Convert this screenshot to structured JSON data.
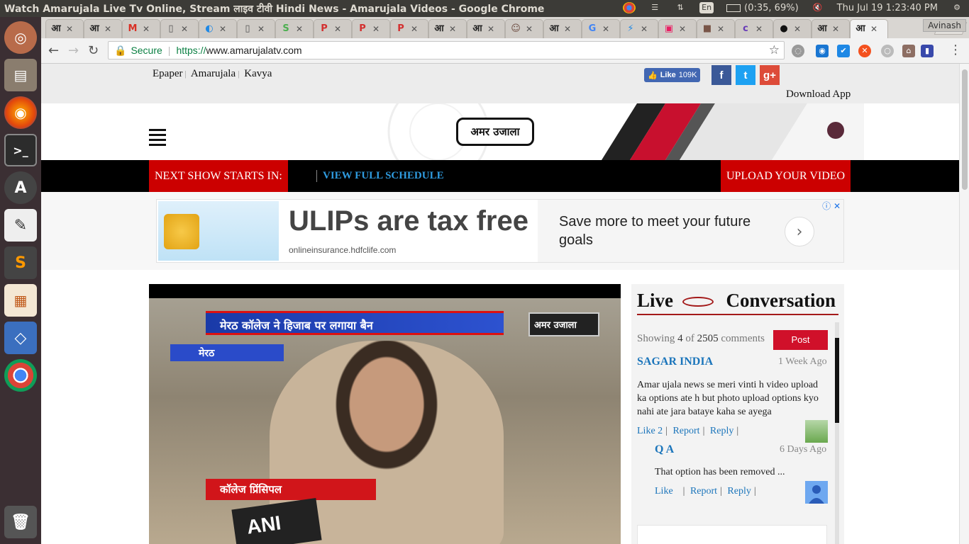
{
  "os": {
    "window_title": "Watch Amarujala Live Tv Online, Stream लाइव टीवी Hindi News - Amarujala Videos - Google Chrome",
    "battery": "(0:35, 69%)",
    "clock": "Thu Jul 19  1:23:40 PM",
    "keyboard": "En",
    "user": "Avinash"
  },
  "launcher": [
    "ubuntu-icon",
    "files-icon",
    "firefox-icon",
    "terminal-icon",
    "software-updater-icon",
    "text-editor-icon",
    "sublime-icon",
    "impress-icon",
    "virtualbox-icon",
    "chrome-icon",
    "trash-icon"
  ],
  "tabs": [
    {
      "icon": "आ",
      "color": "#222"
    },
    {
      "icon": "आ",
      "color": "#222"
    },
    {
      "icon": "M",
      "color": "#d93025"
    },
    {
      "icon": "▯",
      "color": "#555"
    },
    {
      "icon": "◐",
      "color": "#1e88e5"
    },
    {
      "icon": "▯",
      "color": "#555"
    },
    {
      "icon": "S",
      "color": "#4caf50"
    },
    {
      "icon": "P",
      "color": "#d32f2f"
    },
    {
      "icon": "P",
      "color": "#d32f2f"
    },
    {
      "icon": "P",
      "color": "#d32f2f"
    },
    {
      "icon": "आ",
      "color": "#222"
    },
    {
      "icon": "आ",
      "color": "#222"
    },
    {
      "icon": "☺",
      "color": "#6d4c41"
    },
    {
      "icon": "आ",
      "color": "#222"
    },
    {
      "icon": "G",
      "color": "#4285f4"
    },
    {
      "icon": "⚡",
      "color": "#1e88e5"
    },
    {
      "icon": "▣",
      "color": "#e91e63"
    },
    {
      "icon": "■",
      "color": "#795548"
    },
    {
      "icon": "c",
      "color": "#673ab7"
    },
    {
      "icon": "●",
      "color": "#111"
    },
    {
      "icon": "आ",
      "color": "#222"
    },
    {
      "icon": "आ",
      "color": "#222"
    }
  ],
  "omnibox": {
    "secure": "Secure",
    "protocol": "https://",
    "host": "www.amarujalatv.com"
  },
  "site": {
    "top_links": [
      "Epaper",
      "Amarujala",
      "Kavya"
    ],
    "fb_like": "Like",
    "fb_like_count": "109K",
    "social": [
      {
        "icon": "f",
        "color": "#3b5998"
      },
      {
        "icon": "t",
        "color": "#1da1f2"
      },
      {
        "icon": "g+",
        "color": "#dd4b39"
      }
    ],
    "download_app": "Download App",
    "logo_text": "अमर उजाला",
    "next_show": "NEXT SHOW STARTS IN:",
    "view_schedule": "VIEW FULL SCHEDULE",
    "upload_video": "UPLOAD YOUR VIDEO"
  },
  "ad": {
    "headline": "ULIPs are tax free",
    "domain": "onlineinsurance.hdfclife.com",
    "cta_text": "Save more to meet your future goals",
    "info": "ⓘ ✕"
  },
  "video": {
    "ticker": "मेरठ कॉलेज ने हिजाब पर लगाया बैन",
    "location": "मेरठ",
    "caption": "कॉलेज प्रिंसिपल",
    "mic": "ANI",
    "channel": "अमर उजाला"
  },
  "live": {
    "title_left": "Live",
    "title_right": "Conversation",
    "showing_prefix": "Showing",
    "showing_count": "4",
    "showing_of": "of",
    "showing_total": "2505",
    "showing_suffix": "comments",
    "post_label": "Post",
    "comments": [
      {
        "user": "SAGAR INDIA",
        "time": "1 Week Ago",
        "text": "Amar ujala news se meri vinti h video upload ka options ate h but photo upload options kyo nahi ate jara bataye kaha se ayega",
        "like": "Like 2",
        "report": "Report",
        "reply": "Reply"
      },
      {
        "user": "Q A",
        "time": "6 Days Ago",
        "text": "That option has been removed ...",
        "like": "Like",
        "report": "Report",
        "reply": "Reply"
      }
    ]
  }
}
